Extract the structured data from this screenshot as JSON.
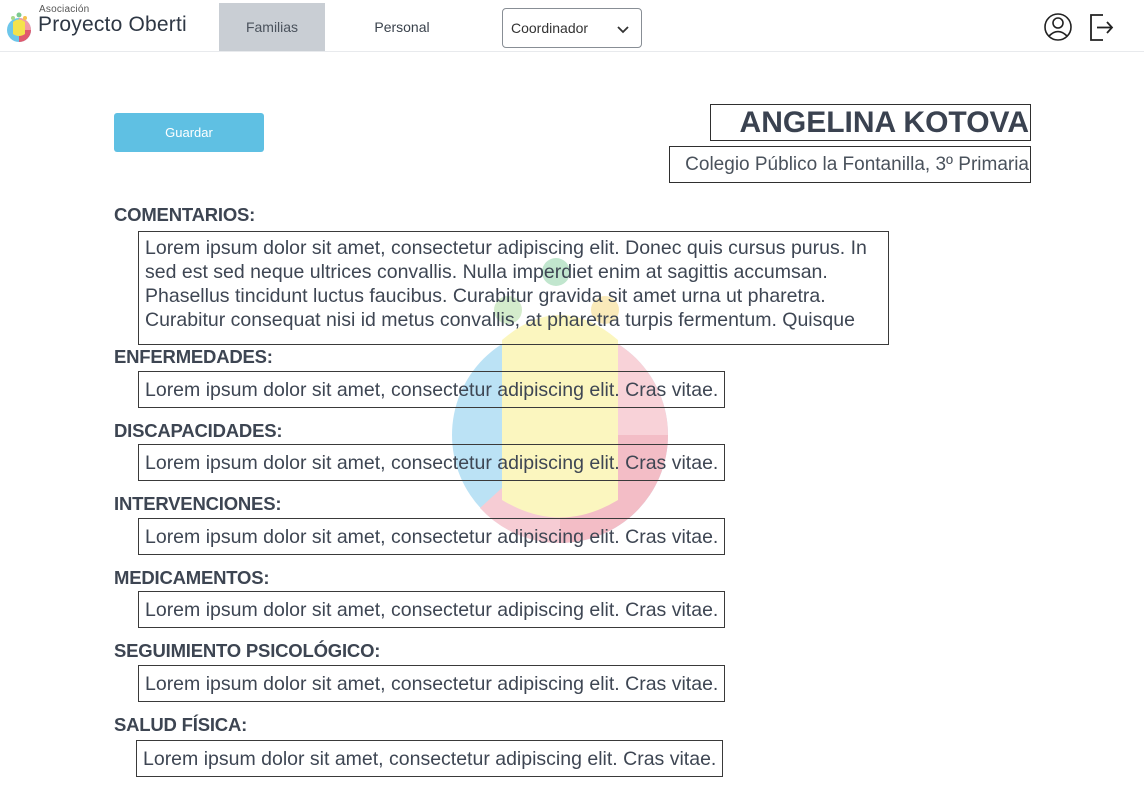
{
  "app": {
    "logo_small": "Asociación",
    "logo_title": "Proyecto Oberti"
  },
  "nav": {
    "tabs": [
      {
        "label": "Familias",
        "active": true
      },
      {
        "label": "Personal",
        "active": false
      }
    ],
    "role_select": {
      "value": "Coordinador"
    }
  },
  "icons": {
    "user": "user-circle-icon",
    "logout": "logout-icon",
    "dropdown": "chevron-down-icon"
  },
  "colors": {
    "save_button": "#5fc0e3",
    "active_tab": "#c9ced4"
  },
  "actions": {
    "save_label": "Guardar"
  },
  "student": {
    "name": "ANGELINA KOTOVA",
    "school": "Colegio Público la Fontanilla, 3º Primaria"
  },
  "sections": {
    "comentarios": {
      "label": "COMENTARIOS:",
      "value": "Lorem ipsum dolor sit amet, consectetur adipiscing elit. Donec quis cursus purus. In sed est sed neque ultrices convallis. Nulla imperdiet enim at sagittis accumsan. Phasellus tincidunt luctus faucibus. Curabitur gravida sit amet urna ut pharetra. Curabitur consequat nisi id metus convallis, at pharetra turpis fermentum. Quisque"
    },
    "enfermedades": {
      "label": "ENFERMEDADES:",
      "value": "Lorem ipsum dolor sit amet, consectetur adipiscing elit. Cras vitae."
    },
    "discapacidades": {
      "label": "DISCAPACIDADES:",
      "value": "Lorem ipsum dolor sit amet, consectetur adipiscing elit. Cras vitae."
    },
    "intervenciones": {
      "label": "INTERVENCIONES:",
      "value": "Lorem ipsum dolor sit amet, consectetur adipiscing elit. Cras vitae."
    },
    "medicamentos": {
      "label": "MEDICAMENTOS:",
      "value": "Lorem ipsum dolor sit amet, consectetur adipiscing elit. Cras vitae."
    },
    "seguimiento": {
      "label": "SEGUIMIENTO PSICOLÓGICO:",
      "value": "Lorem ipsum dolor sit amet, consectetur adipiscing elit. Cras vitae."
    },
    "salud": {
      "label": "SALUD FÍSICA:",
      "value": "Lorem ipsum dolor sit amet, consectetur adipiscing elit. Cras vitae."
    }
  }
}
